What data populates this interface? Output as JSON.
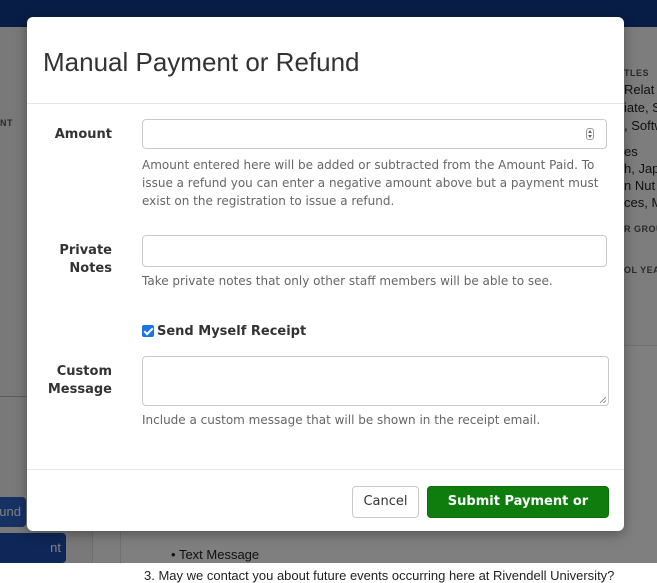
{
  "background": {
    "left_buttons": [
      "fund",
      "nt"
    ],
    "left_label": "NT",
    "right_headings": [
      "TLES",
      "R GROU",
      "OL YEA"
    ],
    "right_lines": [
      "Relat",
      "iate, S",
      ", Softw",
      "es",
      "h, Jap",
      "n Nut",
      "ces, M"
    ],
    "list_item": "Text Message",
    "bottom_line": "3. May we contact you about future events occurring here at Rivendell University?"
  },
  "modal": {
    "title": "Manual Payment or Refund",
    "amount": {
      "label": "Amount",
      "value": "",
      "help": "Amount entered here will be added or subtracted from the Amount Paid. To issue a refund you can enter a negative amount above but a payment must exist on the registration to issue a refund."
    },
    "private_notes": {
      "label_line1": "Private",
      "label_line2": "Notes",
      "value": "",
      "help": "Take private notes that only other staff members will be able to see."
    },
    "send_receipt": {
      "label": "Send Myself Receipt",
      "checked": true
    },
    "custom_message": {
      "label_line1": "Custom",
      "label_line2": "Message",
      "value": "",
      "help": "Include a custom message that will be shown in the receipt email."
    },
    "footer": {
      "cancel_label": "Cancel",
      "submit_label": "Submit Payment or Refund"
    }
  },
  "colors": {
    "topbar": "#0e3a8c",
    "submit": "#0e7d0e",
    "checkbox": "#1a73e8"
  }
}
